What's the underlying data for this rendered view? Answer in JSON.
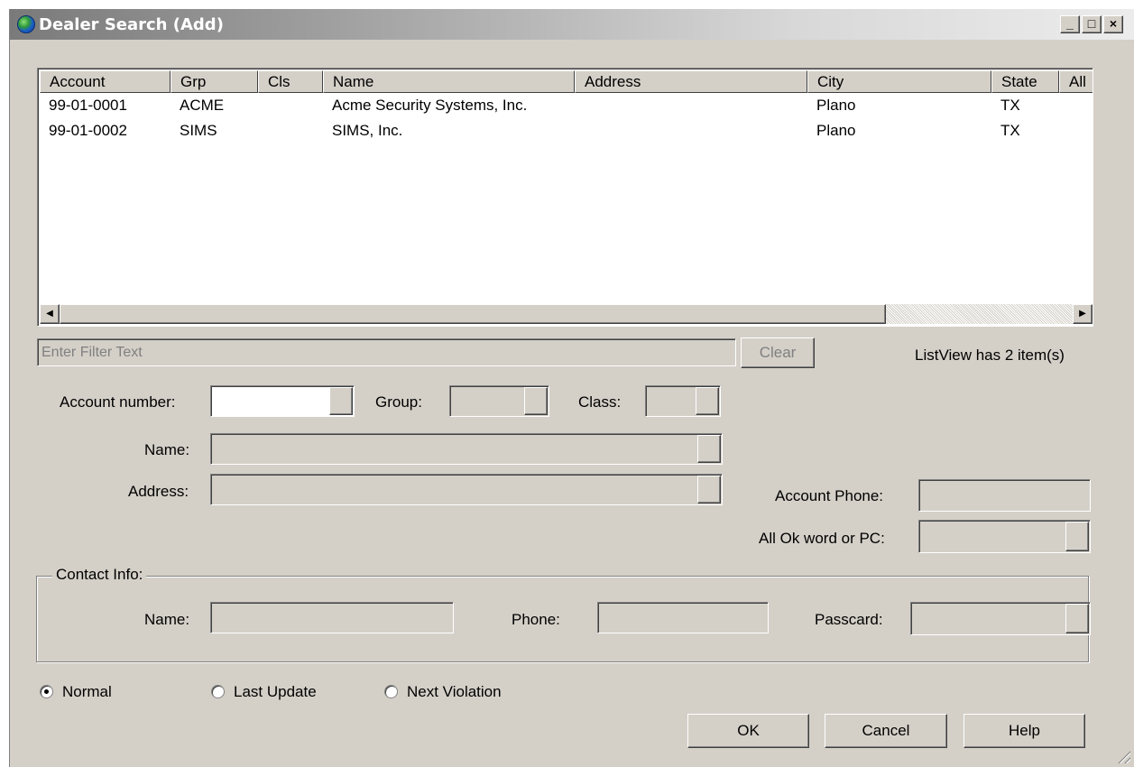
{
  "window": {
    "title": "Dealer Search (Add)",
    "controls": {
      "minimize": "_",
      "maximize": "□",
      "close": "×"
    }
  },
  "list": {
    "columns": [
      "Account",
      "Grp",
      "Cls",
      "Name",
      "Address",
      "City",
      "State",
      "All"
    ],
    "rows": [
      {
        "account": "99-01-0001",
        "grp": "ACME",
        "cls": "",
        "name": "Acme Security Systems, Inc.",
        "address": "",
        "city": "Plano",
        "state": "TX"
      },
      {
        "account": "99-01-0002",
        "grp": "SIMS",
        "cls": "",
        "name": "SIMS, Inc.",
        "address": "",
        "city": "Plano",
        "state": "TX"
      }
    ],
    "scroll_left_icon": "scroll-left-arrow",
    "scroll_right_icon": "scroll-right-arrow"
  },
  "filter": {
    "placeholder": "Enter Filter Text",
    "clear_label": "Clear",
    "status": "ListView has 2 item(s)"
  },
  "form": {
    "account_number_label": "Account number:",
    "group_label": "Group:",
    "class_label": "Class:",
    "name_label": "Name:",
    "address_label": "Address:",
    "account_phone_label": "Account Phone:",
    "all_ok_label": "All Ok word or PC:"
  },
  "contact": {
    "title": "Contact Info:",
    "name_label": "Name:",
    "phone_label": "Phone:",
    "passcard_label": "Passcard:"
  },
  "sort": {
    "options": [
      "Normal",
      "Last Update",
      "Next Violation"
    ],
    "selected": "Normal"
  },
  "buttons": {
    "ok": "OK",
    "cancel": "Cancel",
    "help": "Help"
  },
  "colors": {
    "face": "#d4d0c8",
    "title_text": "#ffffff"
  }
}
